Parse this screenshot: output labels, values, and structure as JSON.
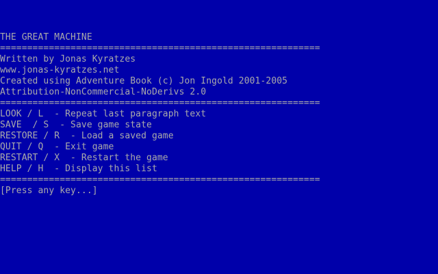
{
  "screen": {
    "background_color": "#0000AA",
    "text_color": "#AAAAAA"
  },
  "header": {
    "title": "THE GREAT MACHINE",
    "rule": "==========================================================="
  },
  "credits": {
    "author": "Written by Jonas Kyratzes",
    "website": "www.jonas-kyratzes.net",
    "engine": "Created using Adventure Book (c) Jon Ingold 2001-2005",
    "license": "Attribution-NonCommercial-NoDerivs 2.0"
  },
  "commands": [
    {
      "text": "LOOK / L  - Repeat last paragraph text"
    },
    {
      "text": "SAVE  / S  - Save game state"
    },
    {
      "text": "RESTORE / R  - Load a saved game"
    },
    {
      "text": "QUIT / Q  - Exit game"
    },
    {
      "text": "RESTART / X  - Restart the game"
    },
    {
      "text": "HELP / H  - Display this list"
    }
  ],
  "prompt": {
    "text": "[Press any key...]"
  }
}
